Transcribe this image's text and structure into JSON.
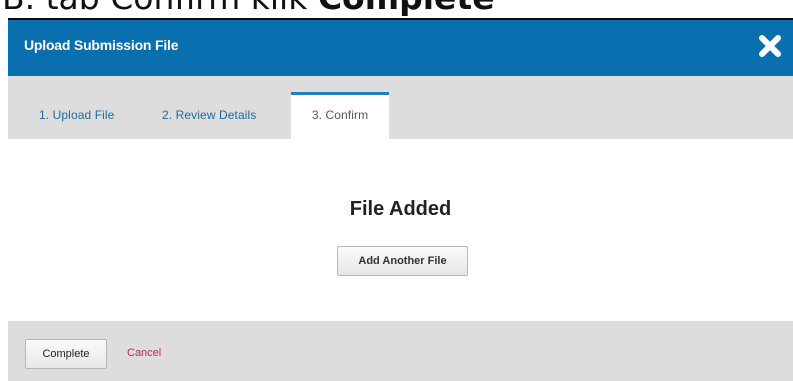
{
  "caption": {
    "prefix": "B. tab Confirm klik ",
    "emphasis": "Complete"
  },
  "dialog": {
    "title": "Upload Submission File",
    "close_icon": "close-icon",
    "header_color": "#0a6fae"
  },
  "tabs": [
    {
      "label": "1. Upload File",
      "active": false
    },
    {
      "label": "2. Review Details",
      "active": false
    },
    {
      "label": "3. Confirm",
      "active": true
    }
  ],
  "content": {
    "heading": "File Added",
    "add_another_label": "Add Another File"
  },
  "footer": {
    "complete_label": "Complete",
    "cancel_label": "Cancel",
    "cancel_color": "#c0276b"
  }
}
